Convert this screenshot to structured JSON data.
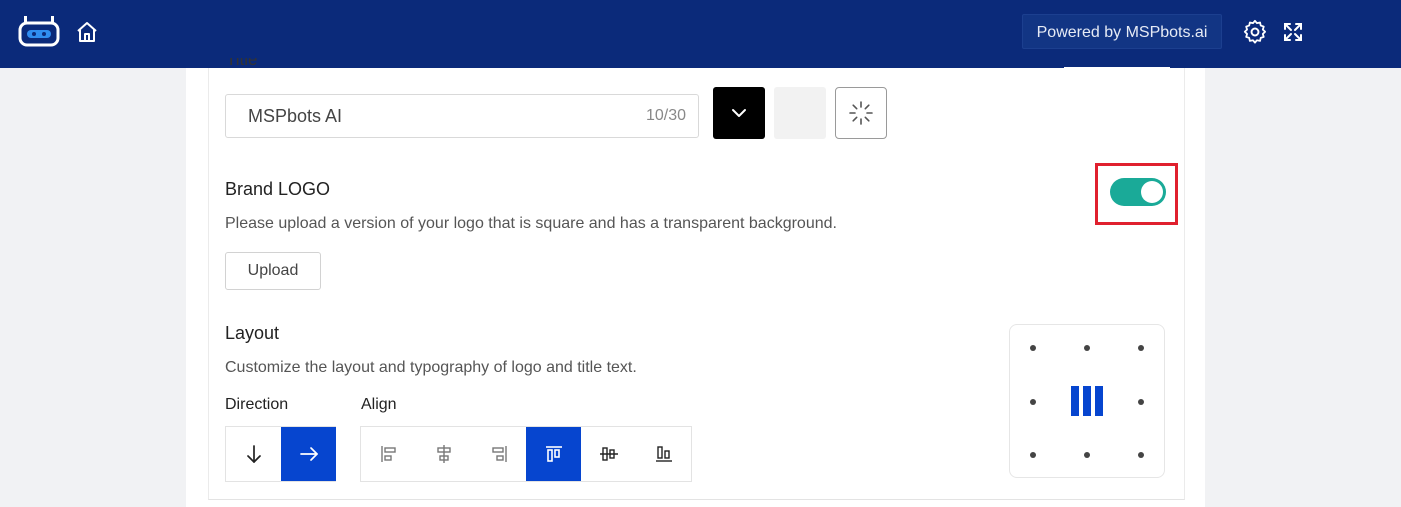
{
  "topbar": {
    "powered_label": "Powered by MSPbots.ai",
    "icons": [
      "bot-logo-icon",
      "home-icon",
      "gear-icon",
      "fullscreen-icon"
    ]
  },
  "title_section": {
    "label_peek": "Title",
    "input_value": "MSPbots AI",
    "counter": "10/30",
    "icons": [
      "chevron-down-icon",
      "spinner-icon"
    ]
  },
  "brand_logo": {
    "label": "Brand LOGO",
    "description": "Please upload a version of your logo that is square and has a transparent background.",
    "upload_label": "Upload",
    "toggle_on": true
  },
  "layout": {
    "label": "Layout",
    "description": "Customize the layout and typography of logo and title text.",
    "direction_label": "Direction",
    "align_label": "Align",
    "direction_options": [
      "arrow-down-icon",
      "arrow-right-icon"
    ],
    "direction_selected": 1,
    "align_options": [
      "align-left-icon",
      "align-center-h-icon",
      "align-right-icon",
      "align-top-icon",
      "align-middle-v-icon",
      "align-bottom-icon"
    ],
    "align_selected": 3
  },
  "colors": {
    "topbar": "#0b2a7a",
    "accent": "#0645cf",
    "toggle": "#1aaa98",
    "highlight": "#e0202e"
  }
}
